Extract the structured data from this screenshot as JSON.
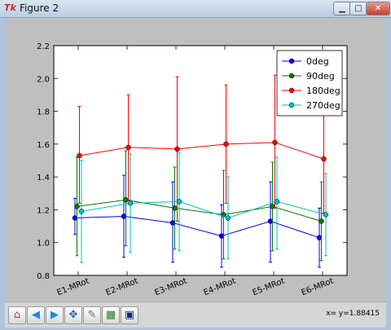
{
  "window": {
    "title": "Figure 2",
    "app_icon": "Tk"
  },
  "toolbar": {
    "buttons": [
      {
        "name": "home-button",
        "icon": "home-icon",
        "glyph": "⌂",
        "color": "#c0392b"
      },
      {
        "name": "back-button",
        "icon": "back-arrow-icon",
        "glyph": "◀",
        "color": "#1e88e5"
      },
      {
        "name": "forward-button",
        "icon": "forward-arrow-icon",
        "glyph": "▶",
        "color": "#1e88e5"
      },
      {
        "name": "pan-button",
        "icon": "pan-move-icon",
        "glyph": "✥",
        "color": "#1565c0"
      },
      {
        "name": "zoom-button",
        "icon": "zoom-rect-icon",
        "glyph": "✎",
        "color": "#6d6d6d"
      },
      {
        "name": "configure-subplots-button",
        "icon": "subplots-icon",
        "glyph": "▦",
        "color": "#2e7d32"
      },
      {
        "name": "save-button",
        "icon": "save-disk-icon",
        "glyph": "▣",
        "color": "#1a237e"
      }
    ],
    "status": "x= y=1.88415"
  },
  "chart_data": {
    "type": "line",
    "categories": [
      "E1-MRot",
      "E2-MRot",
      "E3-MRot",
      "E4-MRot",
      "E5-MRot",
      "E6-MRot"
    ],
    "ylim": [
      0.8,
      2.2
    ],
    "yticks": [
      "0.8",
      "1.0",
      "1.2",
      "1.4",
      "1.6",
      "1.8",
      "2.0",
      "2.2"
    ],
    "legend_position": "top-right",
    "grid": false,
    "series": [
      {
        "name": "0deg",
        "color": "#0000ff",
        "values": [
          1.15,
          1.16,
          1.12,
          1.04,
          1.13,
          1.03
        ],
        "err": [
          [
            1.05,
            1.27
          ],
          [
            0.91,
            1.41
          ],
          [
            0.88,
            1.37
          ],
          [
            0.85,
            1.23
          ],
          [
            0.88,
            1.37
          ],
          [
            0.85,
            1.21
          ]
        ]
      },
      {
        "name": "90deg",
        "color": "#007a00",
        "values": [
          1.22,
          1.26,
          1.21,
          1.17,
          1.22,
          1.13
        ],
        "err": [
          [
            0.92,
            1.52
          ],
          [
            0.98,
            1.56
          ],
          [
            0.96,
            1.46
          ],
          [
            0.9,
            1.44
          ],
          [
            0.95,
            1.49
          ],
          [
            0.89,
            1.37
          ]
        ]
      },
      {
        "name": "180deg",
        "color": "#ff0000",
        "values": [
          1.53,
          1.58,
          1.57,
          1.6,
          1.61,
          1.51
        ],
        "err": [
          [
            1.24,
            1.83
          ],
          [
            1.26,
            1.9
          ],
          [
            1.13,
            2.01
          ],
          [
            1.24,
            1.96
          ],
          [
            1.21,
            2.02
          ],
          [
            1.18,
            1.84
          ]
        ]
      },
      {
        "name": "270deg",
        "color": "#00bfbf",
        "values": [
          1.19,
          1.24,
          1.25,
          1.15,
          1.25,
          1.17
        ],
        "err": [
          [
            0.88,
            1.5
          ],
          [
            0.94,
            1.54
          ],
          [
            0.95,
            1.55
          ],
          [
            0.9,
            1.4
          ],
          [
            0.96,
            1.52
          ],
          [
            0.92,
            1.42
          ]
        ]
      }
    ]
  }
}
